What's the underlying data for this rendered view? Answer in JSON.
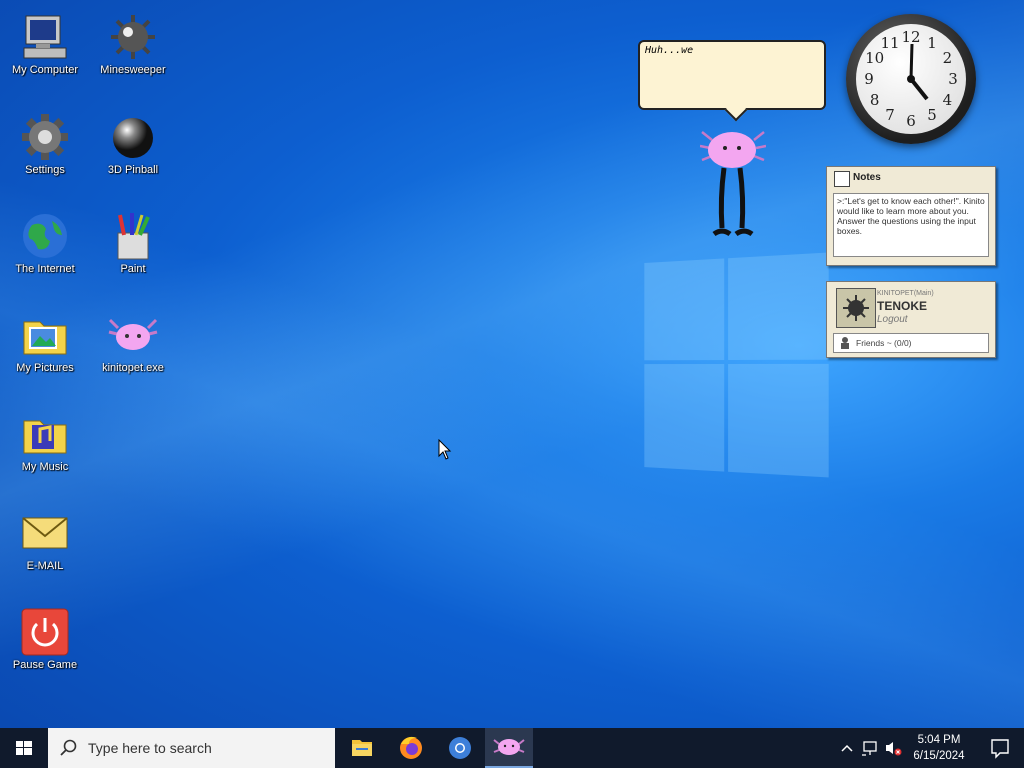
{
  "desktop": {
    "icons": [
      {
        "label": "My Computer",
        "icon": "computer-icon"
      },
      {
        "label": "Minesweeper",
        "icon": "mine-icon"
      },
      {
        "label": "Settings",
        "icon": "gear-icon"
      },
      {
        "label": "3D Pinball",
        "icon": "pinball-icon"
      },
      {
        "label": "The Internet",
        "icon": "globe-icon"
      },
      {
        "label": "Paint",
        "icon": "paint-icon"
      },
      {
        "label": "My Pictures",
        "icon": "pictures-folder-icon"
      },
      {
        "label": "kinitopet.exe",
        "icon": "axolotl-icon"
      },
      {
        "label": "My Music",
        "icon": "music-folder-icon"
      },
      {
        "label": "E-MAIL",
        "icon": "envelope-icon"
      },
      {
        "label": "Pause Game",
        "icon": "power-icon"
      }
    ]
  },
  "pet": {
    "speech": "Huh...we"
  },
  "clock": {
    "numbers": [
      "12",
      "1",
      "2",
      "3",
      "4",
      "5",
      "6",
      "7",
      "8",
      "9",
      "10",
      "11"
    ],
    "time": "5:04"
  },
  "notes": {
    "title": "Notes",
    "text": ">:\"Let's get to know each other!\". Kinito would like to learn more about you. Answer the questions using the input boxes."
  },
  "profile": {
    "small_label": "KINITOPET(Main)",
    "username": "TENOKE",
    "logout": "Logout",
    "friends": "Friends ~ (0/0)"
  },
  "taskbar": {
    "search_placeholder": "Type here to search",
    "apps": [
      {
        "name": "file-explorer-icon"
      },
      {
        "name": "firefox-icon"
      },
      {
        "name": "chrome-icon"
      },
      {
        "name": "kinitopet-icon",
        "active": true
      }
    ],
    "time": "5:04 PM",
    "date": "6/15/2024"
  },
  "colors": {
    "desktop_blue": "#0d5fd0",
    "taskbar": "#101a2c",
    "note_bg": "#f0ead6",
    "pet_pink": "#f3a6f0"
  }
}
